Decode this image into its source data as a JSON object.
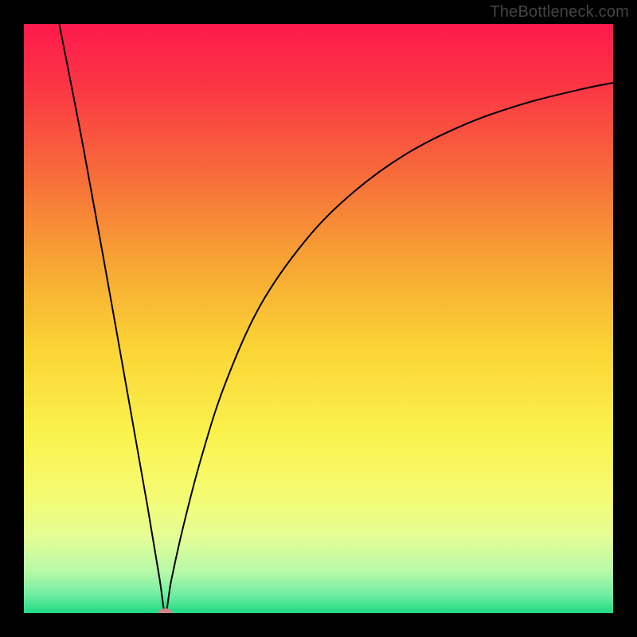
{
  "watermark": "TheBottleneck.com",
  "colors": {
    "frame": "#000000",
    "curve": "#000000",
    "marker": "#d1858a",
    "gradient_stops": [
      {
        "offset": 0.0,
        "color": "#ff1a4d"
      },
      {
        "offset": 0.1,
        "color": "#fb3445"
      },
      {
        "offset": 0.25,
        "color": "#f76a3a"
      },
      {
        "offset": 0.4,
        "color": "#f7a334"
      },
      {
        "offset": 0.55,
        "color": "#fbd435"
      },
      {
        "offset": 0.7,
        "color": "#faf34e"
      },
      {
        "offset": 0.8,
        "color": "#f5fb72"
      },
      {
        "offset": 0.87,
        "color": "#e4fd95"
      },
      {
        "offset": 0.93,
        "color": "#b6f9a8"
      },
      {
        "offset": 0.97,
        "color": "#6eeda2"
      },
      {
        "offset": 1.0,
        "color": "#1fd983"
      }
    ]
  },
  "chart_data": {
    "type": "line",
    "title": "",
    "xlabel": "",
    "ylabel": "",
    "xlim": [
      0,
      100
    ],
    "ylim": [
      0,
      100
    ],
    "curve": {
      "minimum_x": 24.0,
      "minimum_y": 0.0,
      "points": [
        {
          "x": 6.0,
          "y": 100.0
        },
        {
          "x": 10.0,
          "y": 79.5
        },
        {
          "x": 14.0,
          "y": 57.5
        },
        {
          "x": 18.0,
          "y": 35.0
        },
        {
          "x": 21.0,
          "y": 18.0
        },
        {
          "x": 23.0,
          "y": 6.0
        },
        {
          "x": 24.0,
          "y": 0.0
        },
        {
          "x": 25.0,
          "y": 5.5
        },
        {
          "x": 27.0,
          "y": 14.5
        },
        {
          "x": 30.0,
          "y": 26.0
        },
        {
          "x": 34.0,
          "y": 38.5
        },
        {
          "x": 40.0,
          "y": 52.0
        },
        {
          "x": 48.0,
          "y": 63.5
        },
        {
          "x": 56.0,
          "y": 71.5
        },
        {
          "x": 65.0,
          "y": 78.0
        },
        {
          "x": 75.0,
          "y": 83.0
        },
        {
          "x": 85.0,
          "y": 86.5
        },
        {
          "x": 95.0,
          "y": 89.0
        },
        {
          "x": 100.0,
          "y": 90.0
        }
      ]
    },
    "marker": {
      "x": 24.0,
      "y": 0.0,
      "rx": 1.2,
      "ry": 0.8
    }
  }
}
